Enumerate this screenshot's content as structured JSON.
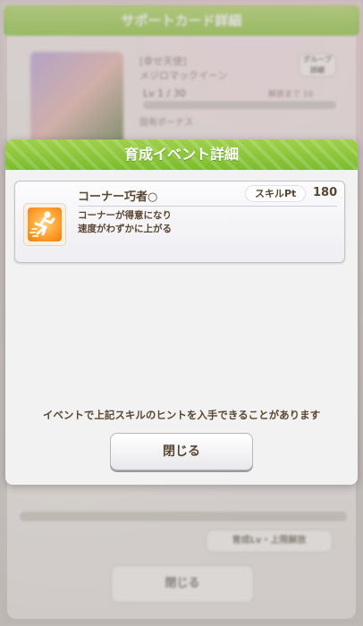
{
  "background": {
    "title": "サポートカード詳細",
    "card_label": "[幸せ天使]",
    "card_sub": "メジロマックイーン",
    "level": "Lv 1 / 30",
    "next": "解放まで 10",
    "effect_label": "固有ボーナス",
    "group_button": "グループ\n詳細",
    "hint_button": "育成Lv・上限解放",
    "close_label": "閉じる"
  },
  "modal": {
    "title": "育成イベント詳細",
    "skill": {
      "name": "コーナー巧者○",
      "points_label": "スキルPt",
      "points_value": "180",
      "description_line1": "コーナーが得意になり",
      "description_line2": "速度がわずかに上がる",
      "icon": "speed-skill-icon",
      "icon_color": "#ff9d2a"
    },
    "notice": "イベントで上記スキルのヒントを入手できることがあります",
    "close_label": "閉じる"
  },
  "colors": {
    "header_green": "#86c23a",
    "text_brown": "#5a4630"
  }
}
